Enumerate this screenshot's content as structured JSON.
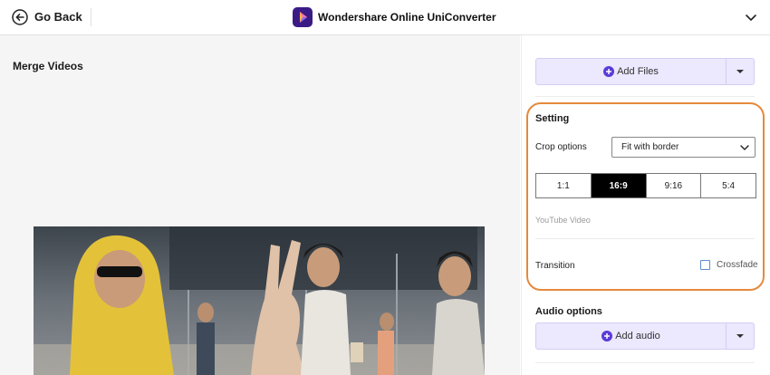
{
  "header": {
    "back_label": "Go Back",
    "app_name": "Wondershare Online UniConverter",
    "icons": [
      "back-arrow-icon",
      "uniconverter-logo",
      "chevron-down-icon"
    ]
  },
  "main": {
    "title": "Merge Videos"
  },
  "sidebar": {
    "add_files_label": "Add Files",
    "setting": {
      "title": "Setting",
      "crop_label": "Crop options",
      "crop_value": "Fit with border",
      "ratios": [
        {
          "label": "1:1",
          "active": false
        },
        {
          "label": "16:9",
          "active": true
        },
        {
          "label": "9:16",
          "active": false
        },
        {
          "label": "5:4",
          "active": false
        }
      ],
      "ratio_description": "YouTube Video",
      "transition_label": "Transition",
      "crossfade_label": "Crossfade",
      "crossfade_checked": false
    },
    "audio": {
      "title": "Audio options",
      "add_audio_label": "Add audio"
    }
  },
  "colors": {
    "accent_button_bg": "#ece8fd",
    "highlight_border": "#e58a3c",
    "active_ratio_bg": "#000000",
    "plus_icon": "#5b3bd6"
  }
}
